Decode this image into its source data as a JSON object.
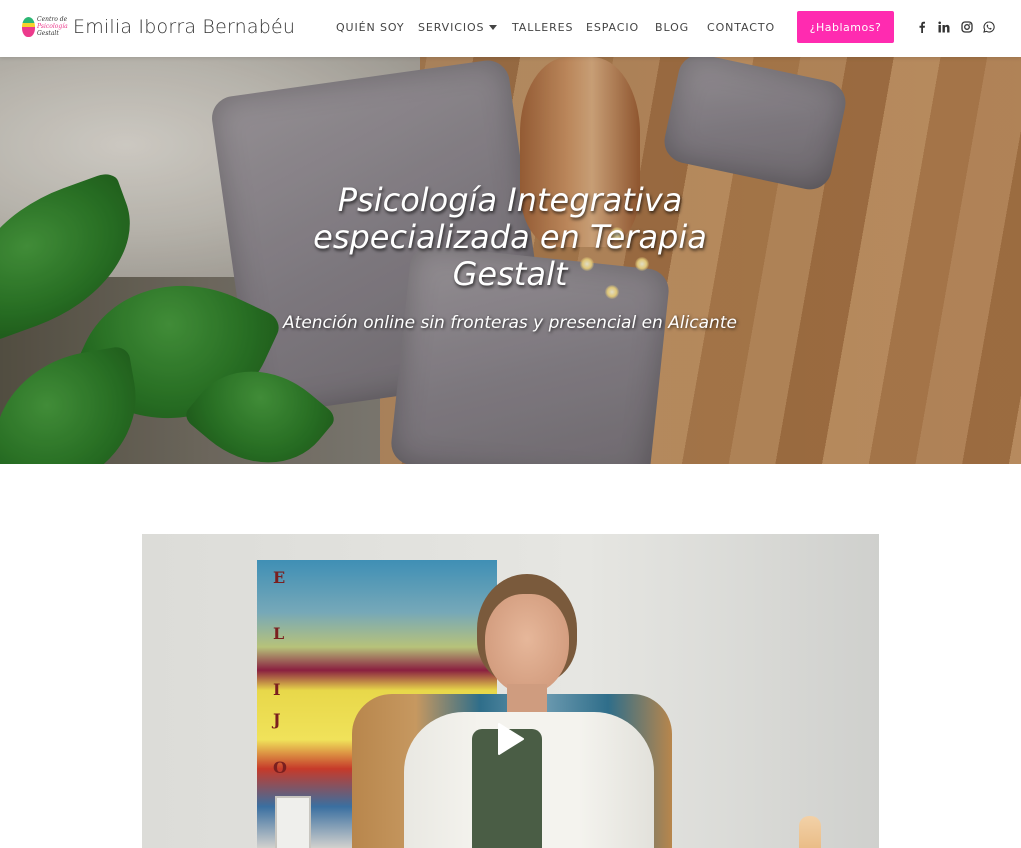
{
  "brand": {
    "logo_text_line1": "Centro de",
    "logo_text_line2": "Psicología",
    "logo_text_line3": "Gestalt",
    "name": "Emilia Iborra Bernabéu"
  },
  "nav": {
    "items": [
      {
        "label": "QUIÉN SOY"
      },
      {
        "label": "SERVICIOS",
        "has_dropdown": true
      },
      {
        "label": "TALLERES"
      },
      {
        "label": "ESPACIO"
      },
      {
        "label": "BLOG"
      },
      {
        "label": "CONTACTO"
      }
    ],
    "cta_label": "¿Hablamos?",
    "social": [
      "facebook-icon",
      "linkedin-icon",
      "instagram-icon",
      "whatsapp-icon"
    ]
  },
  "hero": {
    "title": "Psicología Integrativa especializada en Terapia Gestalt",
    "subtitle": "Atención online sin fronteras y presencial en Alicante"
  },
  "video": {
    "painting_letters": [
      "E",
      "L",
      "I",
      "J",
      "O"
    ]
  },
  "colors": {
    "accent": "#ff2bb0",
    "nav_text": "#444444",
    "hero_text": "#ffffff"
  }
}
